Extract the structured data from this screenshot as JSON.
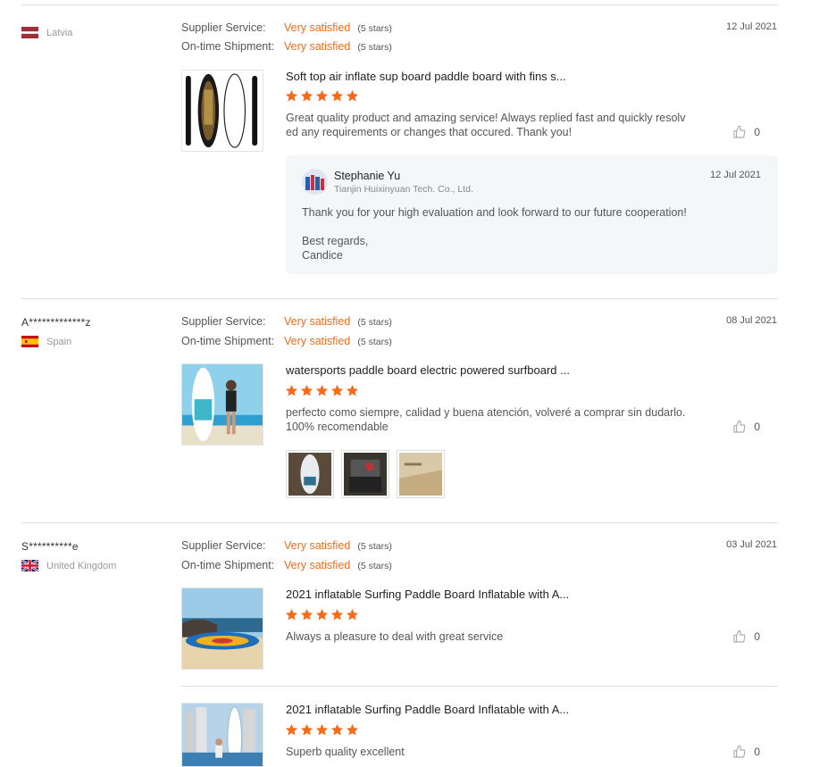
{
  "labels": {
    "supplier_service": "Supplier Service:",
    "on_time_shipment": "On-time Shipment:"
  },
  "colors": {
    "accent": "#f56b17",
    "divider": "#dedede",
    "reply_bg": "#f5f6f8"
  },
  "reviews": [
    {
      "buyer": "",
      "country": "Latvia",
      "flag": "latvia-flag",
      "supplier_service": {
        "value": "Very satisfied",
        "stars": "(5 stars)"
      },
      "on_time_shipment": {
        "value": "Very satisfied",
        "stars": "(5 stars)"
      },
      "date": "12 Jul 2021",
      "products": [
        {
          "title": "Soft top air inflate sup board paddle board with fins s...",
          "rating": 5,
          "comment": "Great quality product and amazing service! Always replied fast and quickly resolved any requirements or changes that occured. Thank you!",
          "likes": "0"
        }
      ],
      "reply": {
        "name": "Stephanie Yu",
        "company": "Tianjin Huixinyuan Tech. Co., Ltd.",
        "date": "12 Jul 2021",
        "text": "Thank you for your high evaluation and look forward to our future cooperation!",
        "regards_line1": "Best regards,",
        "regards_line2": "Candice"
      }
    },
    {
      "buyer": "A*************z",
      "country": "Spain",
      "flag": "spain-flag",
      "supplier_service": {
        "value": "Very satisfied",
        "stars": "(5 stars)"
      },
      "on_time_shipment": {
        "value": "Very satisfied",
        "stars": "(5 stars)"
      },
      "date": "08 Jul 2021",
      "products": [
        {
          "title": "watersports paddle board electric powered surfboard ...",
          "rating": 5,
          "comment": "perfecto como siempre, calidad y buena atención, volveré a comprar sin dudarlo. 100% recomendable",
          "likes": "0",
          "photos": [
            "review-photo-board",
            "review-photo-package",
            "review-photo-box"
          ]
        }
      ]
    },
    {
      "buyer": "S**********e",
      "country": "United Kingdom",
      "flag": "uk-flag",
      "supplier_service": {
        "value": "Very satisfied",
        "stars": "(5 stars)"
      },
      "on_time_shipment": {
        "value": "Very satisfied",
        "stars": "(5 stars)"
      },
      "date": "03 Jul 2021",
      "products": [
        {
          "title": "2021 inflatable Surfing Paddle Board Inflatable with A...",
          "rating": 5,
          "comment": "Always a pleasure to deal with great service",
          "likes": "0"
        },
        {
          "title": "2021 inflatable Surfing Paddle Board Inflatable with A...",
          "rating": 5,
          "comment": "Superb quality excellent",
          "likes": "0"
        }
      ]
    }
  ]
}
